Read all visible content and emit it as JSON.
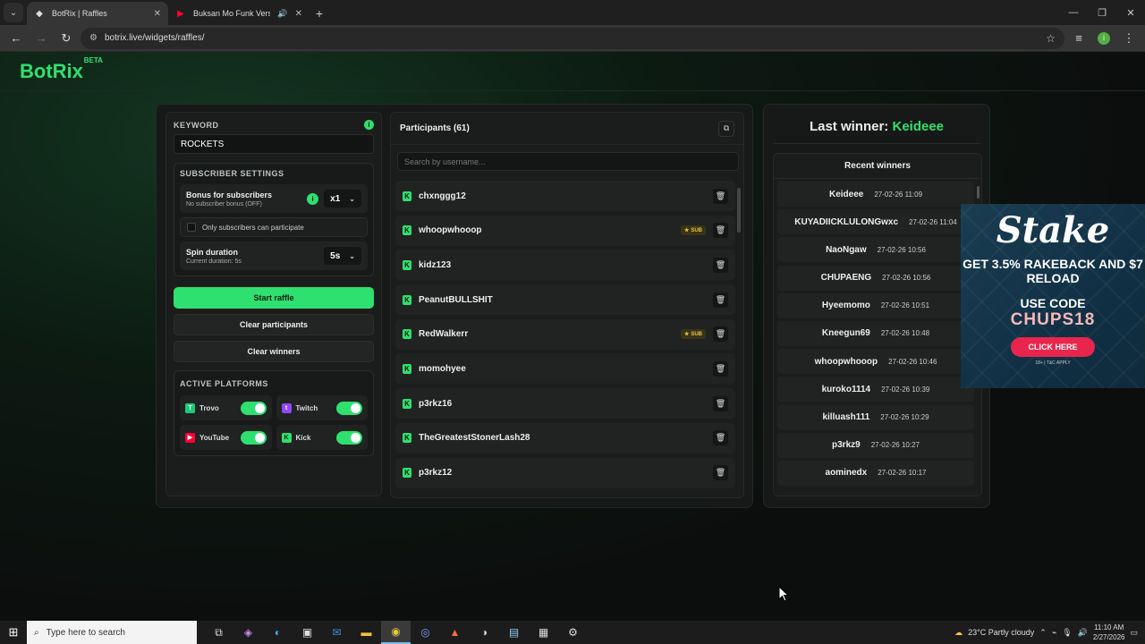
{
  "browser": {
    "tabs": [
      {
        "title": "BotRix | Raffles",
        "active": true
      },
      {
        "title": "Buksan Mo Funk Version - \\",
        "active": false
      }
    ],
    "url": "botrix.live/widgets/raffles/"
  },
  "app": {
    "logo": "BotRix",
    "logo_badge": "BETA"
  },
  "keyword": {
    "label": "KEYWORD",
    "value": "ROCKETS"
  },
  "subscriber_settings": {
    "label": "SUBSCRIBER SETTINGS",
    "bonus_title": "Bonus for subscribers",
    "bonus_sub": "No subscriber bonus (OFF)",
    "bonus_value": "x1",
    "only_subs_label": "Only subscribers can participate",
    "spin_title": "Spin duration",
    "spin_sub": "Current duration: 5s",
    "spin_value": "5s"
  },
  "buttons": {
    "start": "Start raffle",
    "clear_participants": "Clear participants",
    "clear_winners": "Clear winners"
  },
  "platforms": {
    "label": "ACTIVE PLATFORMS",
    "items": [
      {
        "name": "Trovo",
        "color": "#1fc97c",
        "enabled": true
      },
      {
        "name": "Twitch",
        "color": "#9146ff",
        "enabled": true
      },
      {
        "name": "YouTube",
        "color": "#ff0033",
        "enabled": true
      },
      {
        "name": "Kick",
        "color": "#2ee06f",
        "enabled": true
      }
    ]
  },
  "participants": {
    "title": "Participants (61)",
    "search_placeholder": "Search by username...",
    "sub_badge": "SUB",
    "items": [
      {
        "name": "chxnggg12",
        "sub": false
      },
      {
        "name": "whoopwhooop",
        "sub": true
      },
      {
        "name": "kidz123",
        "sub": false
      },
      {
        "name": "PeanutBULLSHIT",
        "sub": false
      },
      {
        "name": "RedWalkerr",
        "sub": true
      },
      {
        "name": "momohyee",
        "sub": false
      },
      {
        "name": "p3rkz16",
        "sub": false
      },
      {
        "name": "TheGreatestStonerLash28",
        "sub": false
      },
      {
        "name": "p3rkz12",
        "sub": false
      }
    ]
  },
  "winners": {
    "last_winner_prefix": "Last winner:",
    "last_winner_name": "Keideee",
    "recent_title": "Recent winners",
    "items": [
      {
        "name": "Keideee",
        "date": "27-02-26 11:09"
      },
      {
        "name": "KUYADIICKLULONGwxc",
        "date": "27-02-26 11:04"
      },
      {
        "name": "NaoNgaw",
        "date": "27-02-26 10:56"
      },
      {
        "name": "CHUPAENG",
        "date": "27-02-26 10:56"
      },
      {
        "name": "Hyeemomo",
        "date": "27-02-26 10:51"
      },
      {
        "name": "Kneegun69",
        "date": "27-02-26 10:48"
      },
      {
        "name": "whoopwhooop",
        "date": "27-02-26 10:46"
      },
      {
        "name": "kuroko1114",
        "date": "27-02-26 10:39"
      },
      {
        "name": "killuash111",
        "date": "27-02-26 10:29"
      },
      {
        "name": "p3rkz9",
        "date": "27-02-26 10:27"
      },
      {
        "name": "aominedx",
        "date": "27-02-26 10:17"
      }
    ]
  },
  "ad": {
    "brand": "Stake",
    "headline": "GET 3.5% RAKEBACK AND $7 RELOAD",
    "code_label": "USE CODE",
    "code": "CHUPS18",
    "cta": "CLICK HERE",
    "disclaimer": "18+ | T&C APPLY"
  },
  "taskbar": {
    "search_placeholder": "Type here to search",
    "weather": "23°C  Partly cloudy",
    "time": "11:10 AM",
    "date": "2/27/2026"
  }
}
